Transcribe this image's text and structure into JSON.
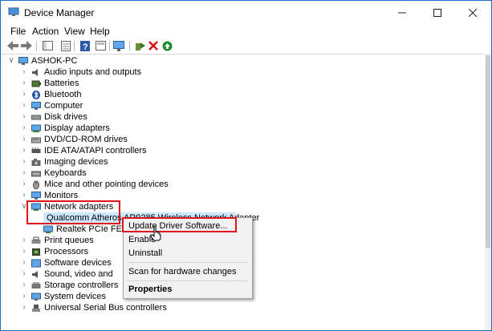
{
  "window": {
    "title": "Device Manager"
  },
  "menu": [
    "File",
    "Action",
    "View",
    "Help"
  ],
  "tree": {
    "root": "ASHOK-PC",
    "categories": [
      "Audio inputs and outputs",
      "Batteries",
      "Bluetooth",
      "Computer",
      "Disk drives",
      "Display adapters",
      "DVD/CD-ROM drives",
      "IDE ATA/ATAPI controllers",
      "Imaging devices",
      "Keyboards",
      "Mice and other pointing devices",
      "Monitors",
      "Network adapters"
    ],
    "network_children": [
      "Qualcomm Atheros AR9285 Wireless Network Adapter",
      "Realtek PCIe FE"
    ],
    "categories_after": [
      "Print queues",
      "Processors",
      "Software devices",
      "Sound, video and",
      "Storage controllers",
      "System devices",
      "Universal Serial Bus controllers"
    ]
  },
  "context_menu": {
    "items": [
      "Update Driver Software...",
      "Enable",
      "Uninstall",
      "Scan for hardware changes",
      "Properties"
    ]
  },
  "colors": {
    "highlight_box": "#e0131b",
    "selection": "#cce8ff",
    "accent": "#1b6fbf"
  },
  "icons": [
    "back-icon",
    "forward-icon",
    "properties-icon",
    "help-icon",
    "monitor-icon",
    "add-driver-icon",
    "remove-icon",
    "enable-icon"
  ]
}
